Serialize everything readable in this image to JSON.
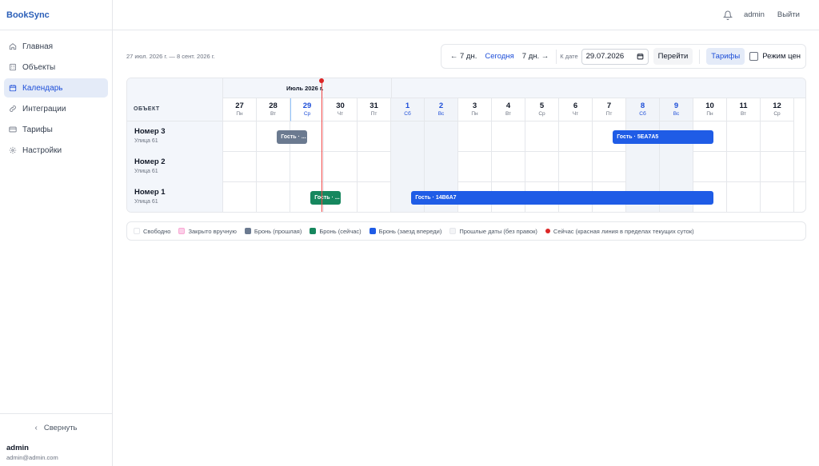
{
  "app": {
    "brand": "BookSync"
  },
  "sidebar": {
    "items": [
      {
        "label": "Главная",
        "icon": "home-icon"
      },
      {
        "label": "Объекты",
        "icon": "building-icon"
      },
      {
        "label": "Календарь",
        "icon": "calendar-icon",
        "active": true
      },
      {
        "label": "Интеграции",
        "icon": "link-icon"
      },
      {
        "label": "Тарифы",
        "icon": "card-icon"
      },
      {
        "label": "Настройки",
        "icon": "gear-icon"
      }
    ],
    "collapse_label": "Свернуть",
    "user_name": "admin",
    "user_email": "admin@admin.com"
  },
  "topbar": {
    "user": "admin",
    "logout": "Выйти"
  },
  "toolbar": {
    "range_text": "27 июл. 2026 г. — 8 сент. 2026 г.",
    "prev": "← 7 дн.",
    "today": "Сегодня",
    "next": "7 дн. →",
    "date_label": "К дате",
    "date_value": "29.07.2026",
    "go": "Перейти",
    "tariffs": "Тарифы",
    "price_mode": "Режим цен"
  },
  "calendar": {
    "month_label": "Июль 2026 г.",
    "object_header": "ОБЪЕКТ",
    "days": [
      {
        "num": "27",
        "wd": "Пн"
      },
      {
        "num": "28",
        "wd": "Вт"
      },
      {
        "num": "29",
        "wd": "Ср",
        "today": true
      },
      {
        "num": "30",
        "wd": "Чт"
      },
      {
        "num": "31",
        "wd": "Пт"
      },
      {
        "num": "1",
        "wd": "Сб",
        "weekend": true
      },
      {
        "num": "2",
        "wd": "Вс",
        "weekend": true
      },
      {
        "num": "3",
        "wd": "Пн"
      },
      {
        "num": "4",
        "wd": "Вт"
      },
      {
        "num": "5",
        "wd": "Ср"
      },
      {
        "num": "6",
        "wd": "Чт"
      },
      {
        "num": "7",
        "wd": "Пт"
      },
      {
        "num": "8",
        "wd": "Сб",
        "weekend": true
      },
      {
        "num": "9",
        "wd": "Вс",
        "weekend": true
      },
      {
        "num": "10",
        "wd": "Пн"
      },
      {
        "num": "11",
        "wd": "Вт"
      },
      {
        "num": "12",
        "wd": "Ср"
      }
    ],
    "rooms": [
      {
        "name": "Номер 3",
        "address": "Улица 61",
        "bookings": [
          {
            "label": "Гость · ...",
            "status": "past",
            "start_day": 1.6,
            "end_day": 2.5
          },
          {
            "label": "Гость · 5EA7A5",
            "status": "future",
            "start_day": 11.6,
            "end_day": 14.6
          }
        ]
      },
      {
        "name": "Номер 2",
        "address": "Улица 61",
        "bookings": []
      },
      {
        "name": "Номер 1",
        "address": "Улица 61",
        "bookings": [
          {
            "label": "Гость · ...",
            "status": "now",
            "start_day": 2.6,
            "end_day": 3.5
          },
          {
            "label": "Гость · 14B6A7",
            "status": "future",
            "start_day": 5.6,
            "end_day": 14.6
          }
        ]
      }
    ],
    "now_day": 2.93
  },
  "legend": [
    {
      "label": "Свободно",
      "swatch": "free"
    },
    {
      "label": "Закрыто вручную",
      "swatch": "closed"
    },
    {
      "label": "Бронь (прошлая)",
      "swatch": "past"
    },
    {
      "label": "Бронь (сейчас)",
      "swatch": "now"
    },
    {
      "label": "Бронь (заезд впереди)",
      "swatch": "future"
    },
    {
      "label": "Прошлые даты (без правок)",
      "swatch": "pastdate"
    },
    {
      "label": "Сейчас (красная линия в пределах текущих суток)",
      "swatch": "dot"
    }
  ]
}
